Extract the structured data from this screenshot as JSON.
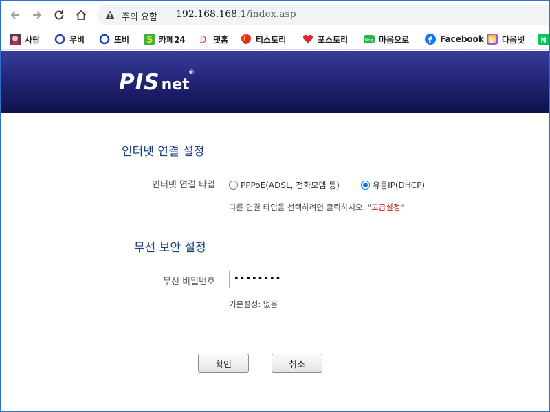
{
  "browser": {
    "security_label": "주의 요함",
    "url_host": "192.168.168.1",
    "url_path": "/index.asp",
    "bookmarks": [
      {
        "label": "사람",
        "icon": "avatar-icon"
      },
      {
        "label": "우비",
        "icon": "circle-icon"
      },
      {
        "label": "또비",
        "icon": "circle-icon"
      },
      {
        "label": "카페24",
        "icon": "cafe24-icon"
      },
      {
        "label": "댓홈",
        "icon": "d-letter-icon"
      },
      {
        "label": "티스토리",
        "icon": "shield-icon"
      },
      {
        "label": "포스토리",
        "icon": "heart-icon"
      },
      {
        "label": "마음으로",
        "icon": "blog-icon"
      },
      {
        "label": "Facebook",
        "icon": "facebook-icon"
      },
      {
        "label": "다음넷",
        "icon": "daum-icon"
      }
    ]
  },
  "header": {
    "logo_main": "PIS",
    "logo_sub": "net",
    "logo_reg": "®"
  },
  "internet": {
    "title": "인터넷 연결 설정",
    "type_label": "인터넷 연결 타입",
    "options": [
      {
        "label": "PPPoE(ADSL, 전화모뎀 등)",
        "checked": false
      },
      {
        "label": "유동IP(DHCP)",
        "checked": true
      }
    ],
    "hint_prefix": "다른 연결 타입을 선택하려면 클릭하시오. \"",
    "hint_link": "고급설정",
    "hint_suffix": "\""
  },
  "wireless": {
    "title": "무선 보안 설정",
    "password_label": "무선 비밀번호",
    "password_value": "••••••••",
    "default_note": "기본설정: 없음"
  },
  "buttons": {
    "ok": "확인",
    "cancel": "취소"
  },
  "colors": {
    "section_title": "#1d3f8a",
    "banner_top": "#3a3d98",
    "banner_bottom": "#10124a",
    "link": "#cc0000",
    "radio_checked": "#0075ff"
  }
}
